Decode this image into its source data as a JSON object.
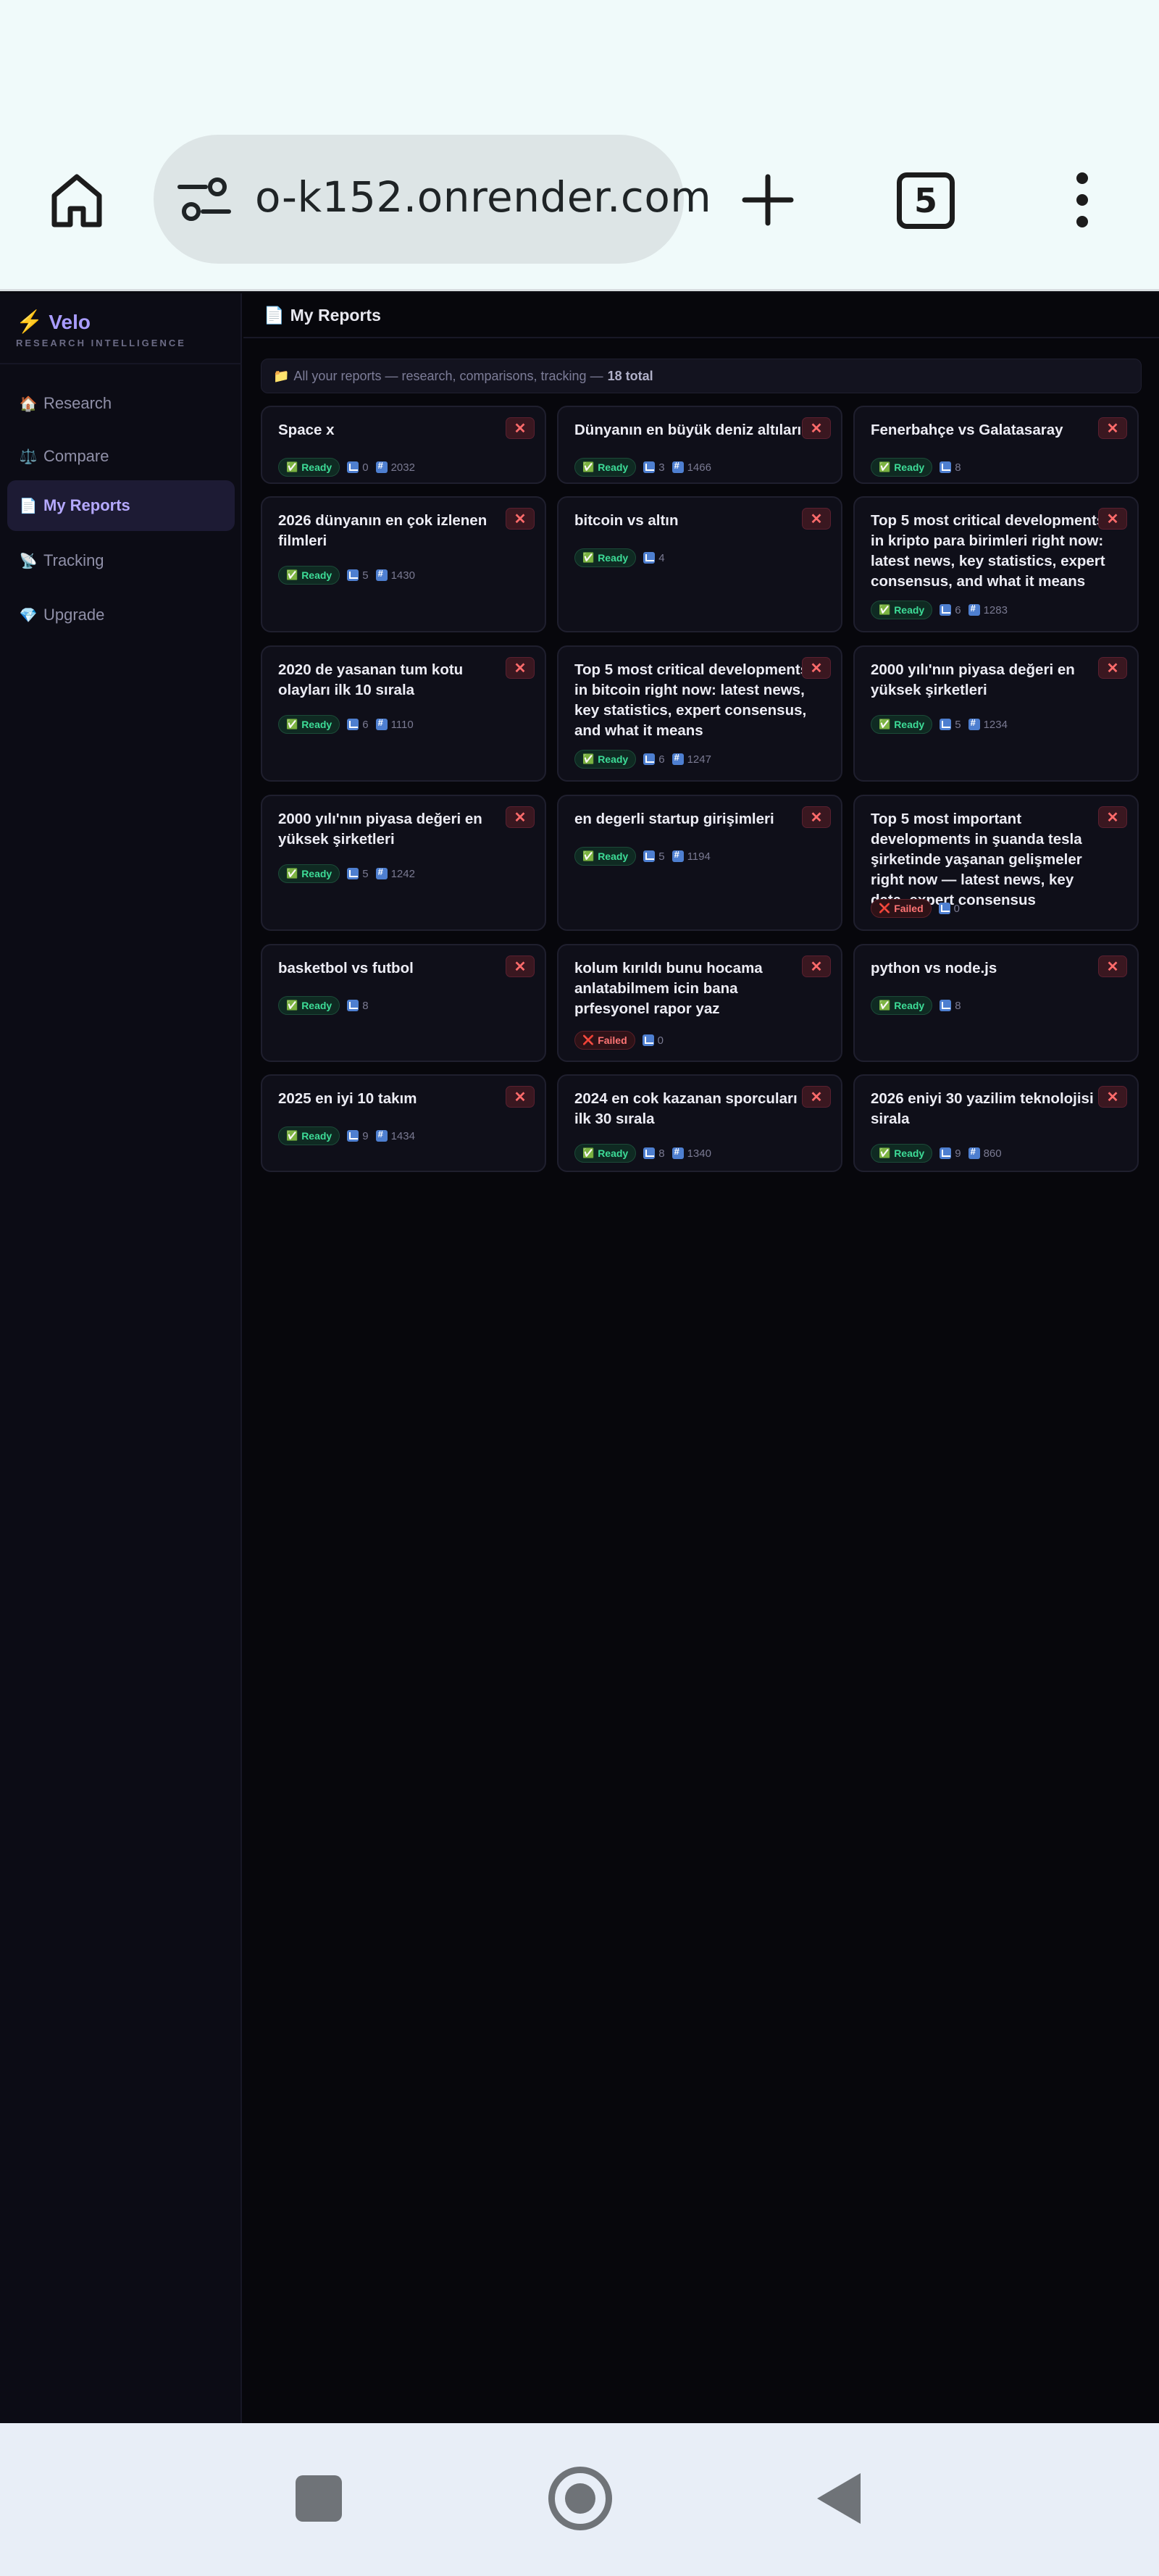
{
  "browser": {
    "url": "o-k152.onrender.com",
    "tab_count": "5"
  },
  "sidebar": {
    "brand": "Velo",
    "brand_sub": "RESEARCH INTELLIGENCE",
    "items": [
      {
        "icon": "🏠",
        "label": "Research"
      },
      {
        "icon": "⚖️",
        "label": "Compare"
      },
      {
        "icon": "📄",
        "label": "My Reports"
      },
      {
        "icon": "📡",
        "label": "Tracking"
      },
      {
        "icon": "💎",
        "label": "Upgrade"
      }
    ]
  },
  "header": {
    "icon": "📄",
    "title": "My Reports"
  },
  "info": {
    "icon": "📁",
    "text": "All your reports — research, comparisons, tracking —",
    "total": "18 total"
  },
  "reports": [
    {
      "title": "Space x",
      "status": "Ready",
      "sources": "0",
      "words": "2032"
    },
    {
      "title": "Dünyanın en büyük deniz altıları",
      "status": "Ready",
      "sources": "3",
      "words": "1466"
    },
    {
      "title": "Fenerbahçe vs Galatasaray",
      "status": "Ready",
      "sources": "8",
      "words": ""
    },
    {
      "title": "2026 dünyanın en çok izlenen filmleri",
      "status": "Ready",
      "sources": "5",
      "words": "1430"
    },
    {
      "title": "bitcoin vs altın",
      "status": "Ready",
      "sources": "4",
      "words": ""
    },
    {
      "title": "Top 5 most critical developments in kripto para birimleri right now: latest news, key statistics, expert consensus, and what it means",
      "status": "Ready",
      "sources": "6",
      "words": "1283"
    },
    {
      "title": "2020 de yasanan tum kotu olayları ilk 10 sırala",
      "status": "Ready",
      "sources": "6",
      "words": "1110"
    },
    {
      "title": "Top 5 most critical developments in bitcoin right now: latest news, key statistics, expert consensus, and what it means",
      "status": "Ready",
      "sources": "6",
      "words": "1247"
    },
    {
      "title": "2000 yılı'nın piyasa değeri en yüksek şirketleri",
      "status": "Ready",
      "sources": "5",
      "words": "1234"
    },
    {
      "title": "2000 yılı'nın piyasa değeri en yüksek şirketleri",
      "status": "Ready",
      "sources": "5",
      "words": "1242"
    },
    {
      "title": "en degerli startup girişimleri",
      "status": "Ready",
      "sources": "5",
      "words": "1194"
    },
    {
      "title": "Top 5 most important developments in şuanda tesla şirketinde yaşanan gelişmeler right now — latest news, key data, expert consensus",
      "status": "Failed",
      "sources": "0",
      "words": ""
    },
    {
      "title": "basketbol vs futbol",
      "status": "Ready",
      "sources": "8",
      "words": ""
    },
    {
      "title": "kolum kırıldı bunu hocama anlatabilmem icin bana prfesyonel rapor yaz",
      "status": "Failed",
      "sources": "0",
      "words": ""
    },
    {
      "title": "python vs node.js",
      "status": "Ready",
      "sources": "8",
      "words": ""
    },
    {
      "title": "2025 en iyi 10 takım",
      "status": "Ready",
      "sources": "9",
      "words": "1434"
    },
    {
      "title": "2024 en cok kazanan sporcuları ilk 30 sırala",
      "status": "Ready",
      "sources": "8",
      "words": "1340"
    },
    {
      "title": "2026 eniyi 30 yazilim teknolojisi sirala",
      "status": "Ready",
      "sources": "9",
      "words": "860"
    }
  ],
  "icons": {
    "ready": "✅",
    "failed": "❌",
    "delete": "✕"
  }
}
